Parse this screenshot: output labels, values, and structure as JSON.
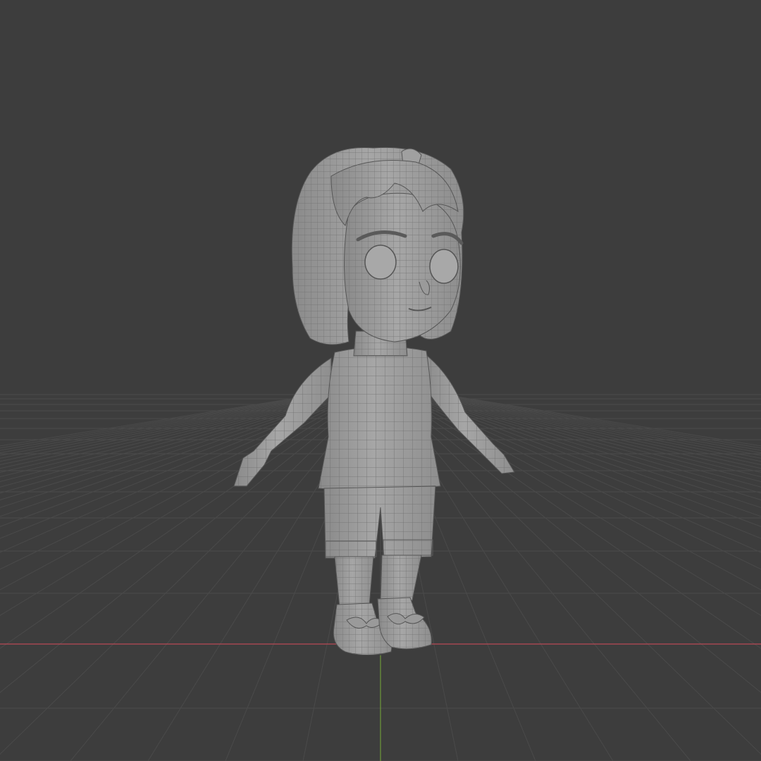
{
  "viewport": {
    "background_color": "#3d3d3d",
    "grid_color": "#4a4a4a",
    "x_axis_color": "#b84a55",
    "y_axis_color": "#6f9a3a",
    "model_color": "#9c9c9c",
    "wire_color": "#6e6e6e"
  },
  "model": {
    "pose": "T-pose",
    "display": "wireframe-on-shaded"
  }
}
